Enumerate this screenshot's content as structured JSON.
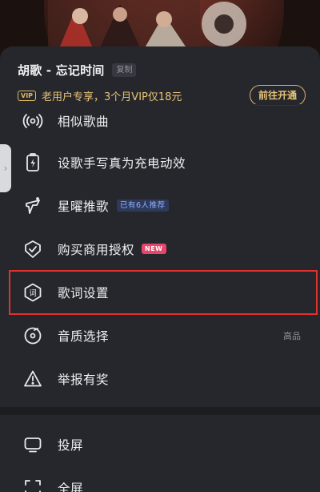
{
  "song": {
    "title": "胡歌 - 忘记时间",
    "copy_label": "复制"
  },
  "vip": {
    "badge": "VIP",
    "text": "老用户专享，3个月VIP仅18元",
    "button": "前往开通"
  },
  "menu": {
    "items": [
      {
        "label": "相似歌曲",
        "icon": "radio-wave-icon"
      },
      {
        "label": "设歌手写真为充电动效",
        "icon": "battery-charge-icon"
      },
      {
        "label": "星曜推歌",
        "icon": "star-recommend-icon",
        "tag": "已有6人推荐"
      },
      {
        "label": "购买商用授权",
        "icon": "shield-check-icon",
        "tag": "NEW"
      },
      {
        "label": "歌词设置",
        "icon": "lyrics-icon"
      },
      {
        "label": "音质选择",
        "icon": "disc-icon",
        "value": "高品"
      },
      {
        "label": "举报有奖",
        "icon": "warning-icon"
      },
      {
        "label": "投屏",
        "icon": "cast-screen-icon"
      },
      {
        "label": "全屏",
        "icon": "fullscreen-icon"
      }
    ]
  },
  "colors": {
    "sheet_bg": "#25272c",
    "vip_gold": "#e8c377",
    "highlight_red": "#e2302f",
    "new_tag": "#e8456b"
  }
}
